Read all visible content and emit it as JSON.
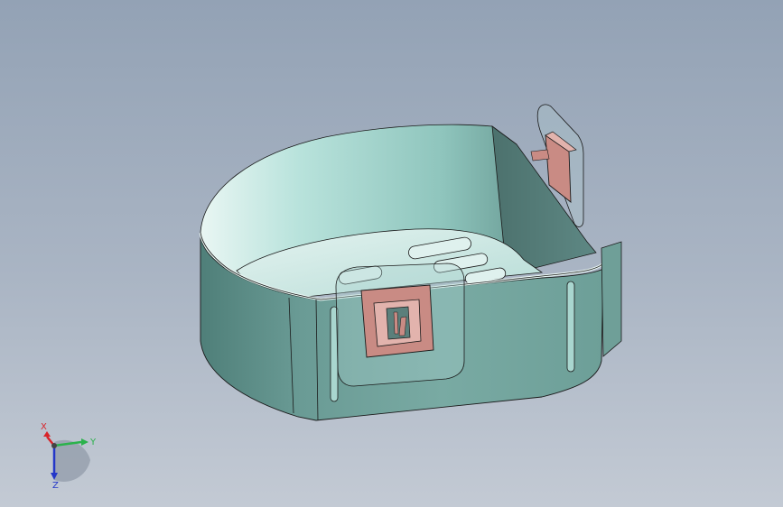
{
  "viewport": {
    "bg_top": "#93a2b5",
    "bg_bottom": "#c3cad4"
  },
  "model": {
    "body_color": "#74a59e",
    "body_light": "#a9d6cf",
    "inner_color": "#cfe9e4",
    "clip_color": "#c98b84",
    "edge_color": "#1a1a1a"
  },
  "triad": {
    "x_label": "X",
    "y_label": "Y",
    "z_label": "Z",
    "x_color": "#d8242a",
    "y_color": "#2bb24c",
    "z_color": "#2437c8"
  }
}
